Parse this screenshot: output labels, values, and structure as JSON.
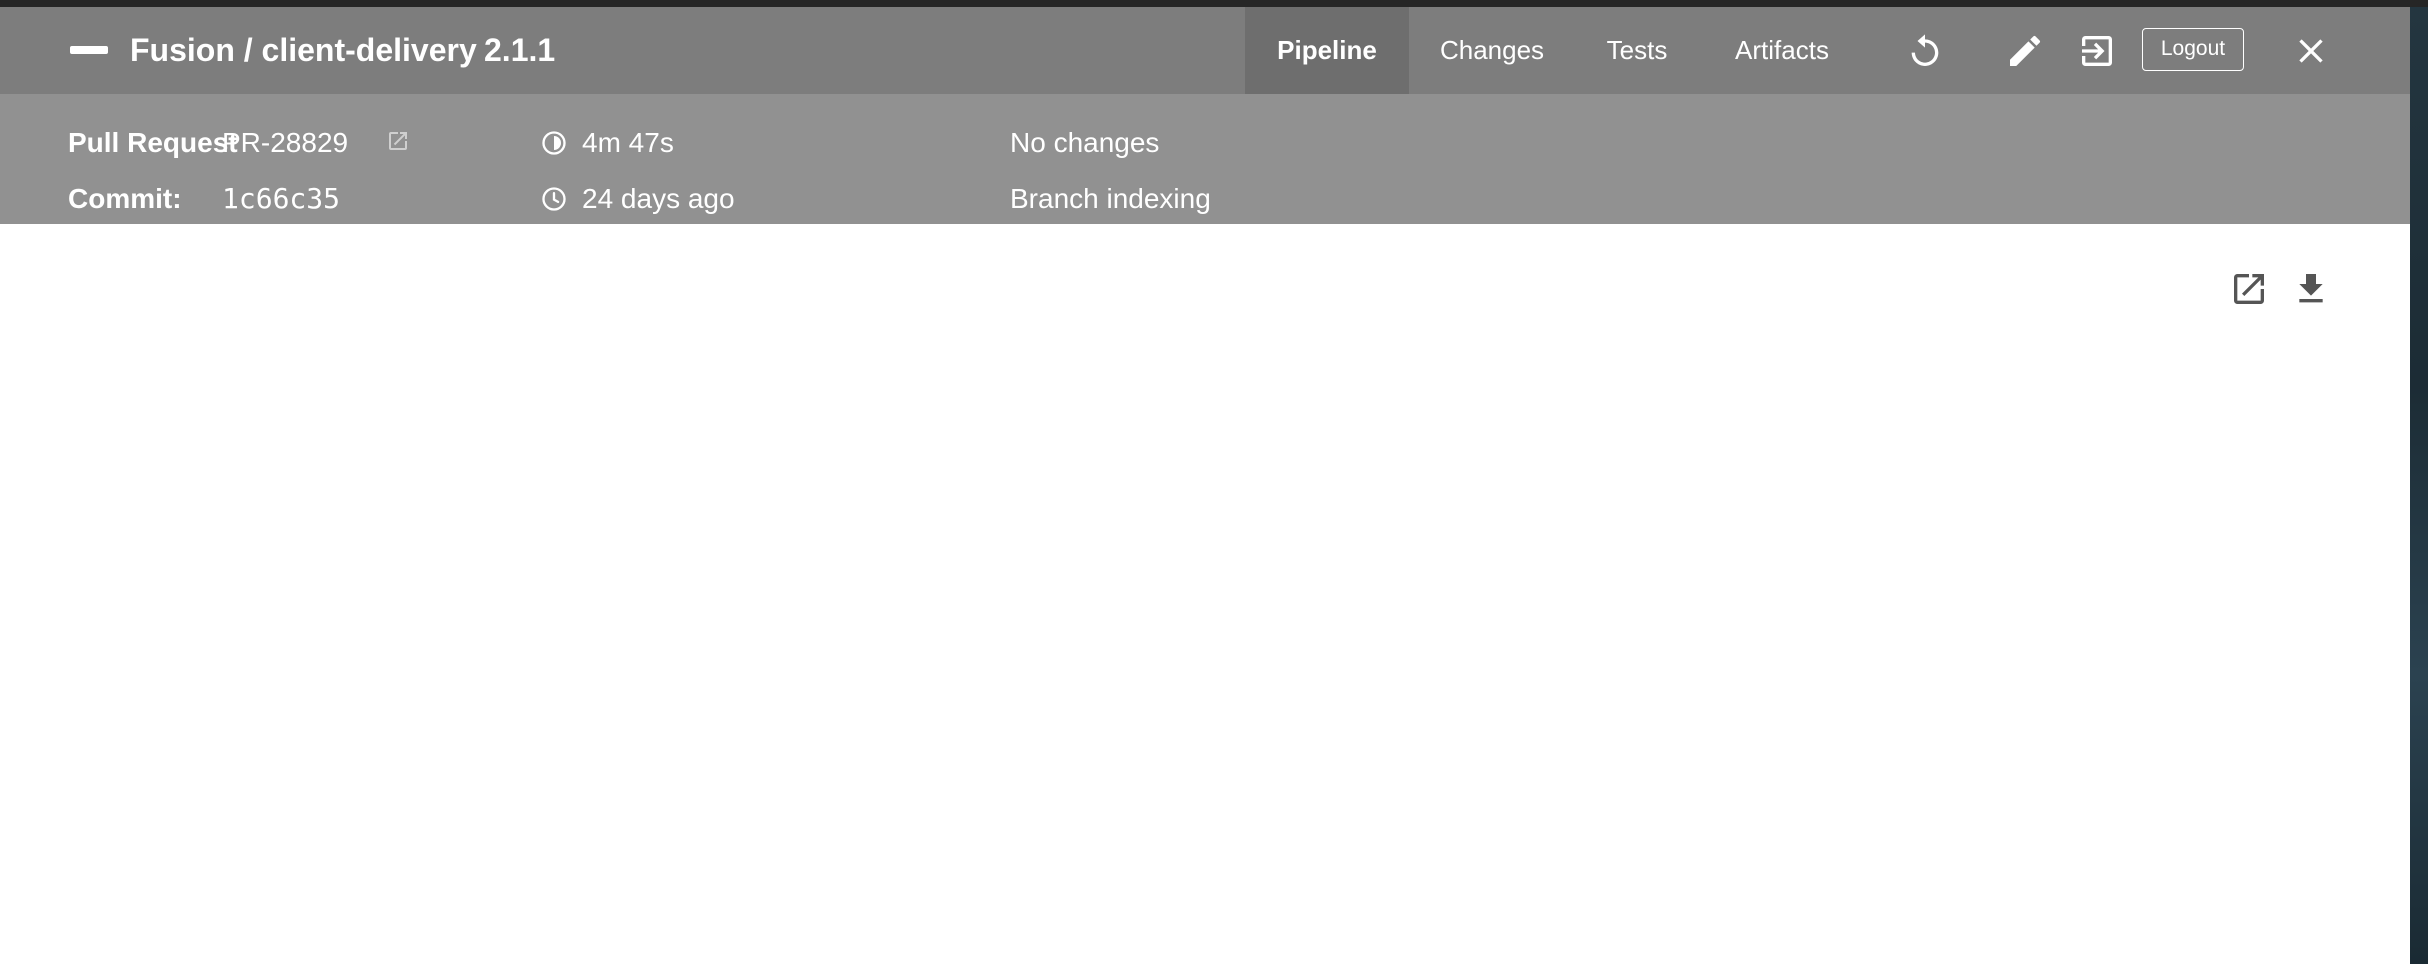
{
  "header": {
    "title": "Fusion / client-delivery",
    "version": "2.1.1",
    "tabs": [
      {
        "label": "Pipeline",
        "active": true
      },
      {
        "label": "Changes",
        "active": false
      },
      {
        "label": "Tests",
        "active": false
      },
      {
        "label": "Artifacts",
        "active": false
      }
    ],
    "logout_label": "Logout",
    "icons": [
      "minus-icon",
      "rerun-icon",
      "edit-icon",
      "open-classic-icon",
      "close-icon"
    ]
  },
  "meta": {
    "pull_request_label": "Pull Request",
    "pull_request_value": "PR-28829",
    "commit_label": "Commit:",
    "commit_value": "1c66c35",
    "duration": "4m 47s",
    "time_ago": "24 days ago",
    "changes": "No changes",
    "cause": "Branch indexing"
  },
  "content": {
    "icons": [
      "external-link-icon",
      "download-icon"
    ]
  },
  "colors": {
    "header_bg": "#7d7d7d",
    "active_tab_bg": "#6e6e6e",
    "meta_bg": "#919191",
    "text": "#ffffff"
  }
}
